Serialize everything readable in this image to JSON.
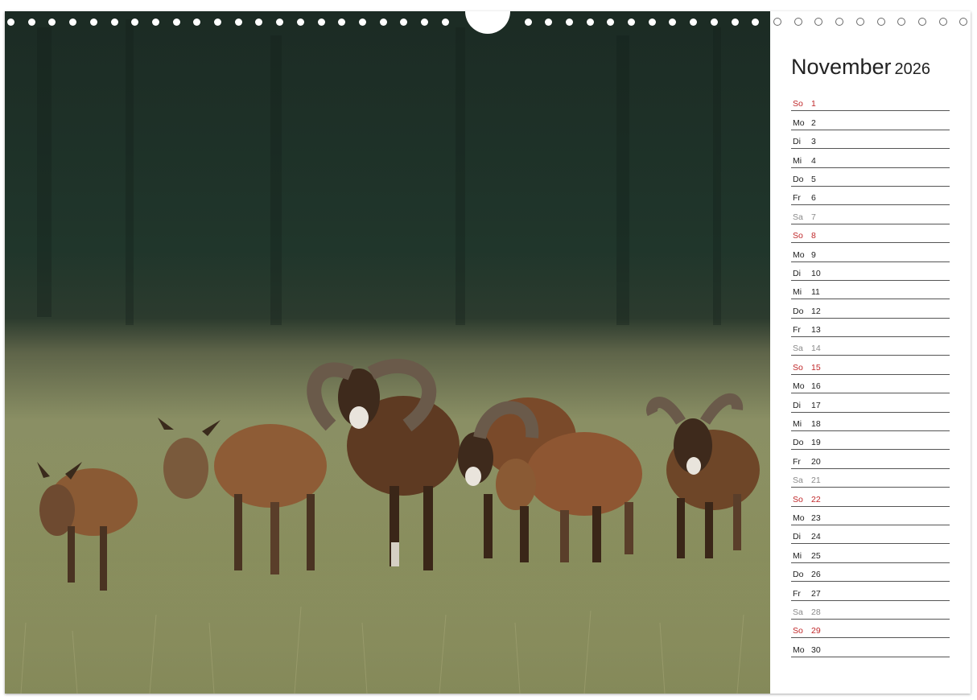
{
  "calendar": {
    "month": "November",
    "year": "2026",
    "days": [
      {
        "wd": "So",
        "num": "1",
        "type": "sun"
      },
      {
        "wd": "Mo",
        "num": "2",
        "type": "week"
      },
      {
        "wd": "Di",
        "num": "3",
        "type": "week"
      },
      {
        "wd": "Mi",
        "num": "4",
        "type": "week"
      },
      {
        "wd": "Do",
        "num": "5",
        "type": "week"
      },
      {
        "wd": "Fr",
        "num": "6",
        "type": "week"
      },
      {
        "wd": "Sa",
        "num": "7",
        "type": "sat"
      },
      {
        "wd": "So",
        "num": "8",
        "type": "sun"
      },
      {
        "wd": "Mo",
        "num": "9",
        "type": "week"
      },
      {
        "wd": "Di",
        "num": "10",
        "type": "week"
      },
      {
        "wd": "Mi",
        "num": "11",
        "type": "week"
      },
      {
        "wd": "Do",
        "num": "12",
        "type": "week"
      },
      {
        "wd": "Fr",
        "num": "13",
        "type": "week"
      },
      {
        "wd": "Sa",
        "num": "14",
        "type": "sat"
      },
      {
        "wd": "So",
        "num": "15",
        "type": "sun"
      },
      {
        "wd": "Mo",
        "num": "16",
        "type": "week"
      },
      {
        "wd": "Di",
        "num": "17",
        "type": "week"
      },
      {
        "wd": "Mi",
        "num": "18",
        "type": "week"
      },
      {
        "wd": "Do",
        "num": "19",
        "type": "week"
      },
      {
        "wd": "Fr",
        "num": "20",
        "type": "week"
      },
      {
        "wd": "Sa",
        "num": "21",
        "type": "sat"
      },
      {
        "wd": "So",
        "num": "22",
        "type": "sun"
      },
      {
        "wd": "Mo",
        "num": "23",
        "type": "week"
      },
      {
        "wd": "Di",
        "num": "24",
        "type": "week"
      },
      {
        "wd": "Mi",
        "num": "25",
        "type": "week"
      },
      {
        "wd": "Do",
        "num": "26",
        "type": "week"
      },
      {
        "wd": "Fr",
        "num": "27",
        "type": "week"
      },
      {
        "wd": "Sa",
        "num": "28",
        "type": "sat"
      },
      {
        "wd": "So",
        "num": "29",
        "type": "sun"
      },
      {
        "wd": "Mo",
        "num": "30",
        "type": "week"
      }
    ]
  },
  "colors": {
    "sunday": "#c0282a",
    "saturday": "#8a8a8a",
    "forest": "#1f3328",
    "meadow": "#8e9363",
    "fur": "#7a4a2a"
  },
  "photo": {
    "subject": "mouflon-herd-icon"
  }
}
